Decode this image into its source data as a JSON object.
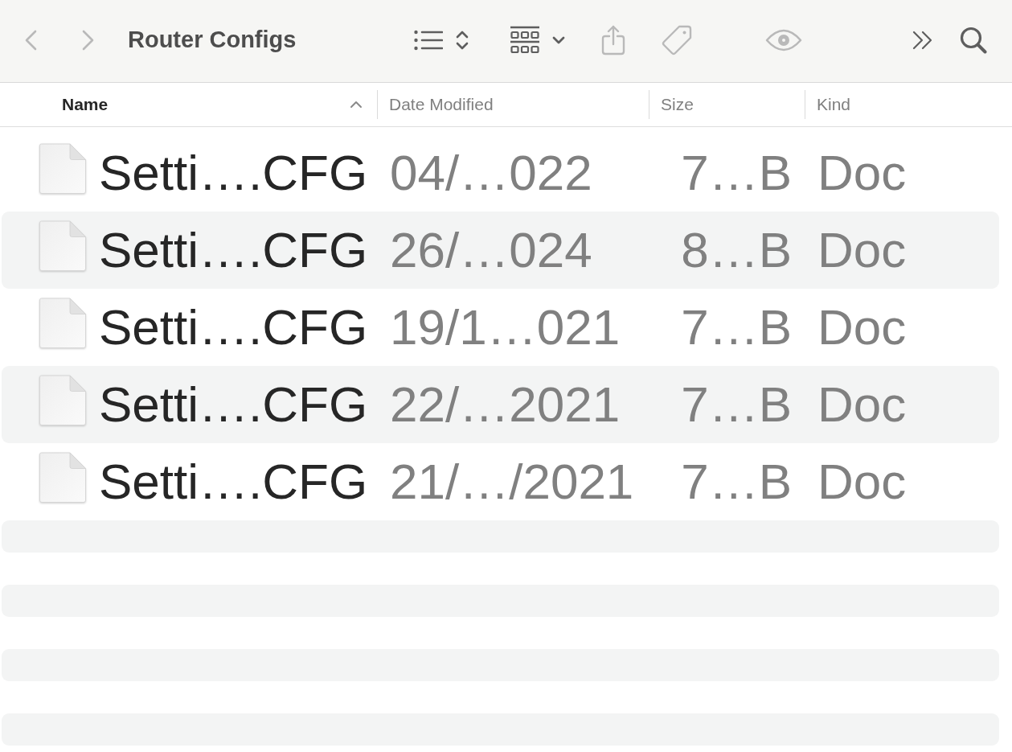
{
  "toolbar": {
    "back_button": {
      "disabled": true
    },
    "forward_button": {
      "disabled": true
    },
    "title": "Router Configs",
    "view_button": {
      "disabled": false
    },
    "group_button": {
      "disabled": false
    },
    "share_button": {
      "disabled": true
    },
    "tag_button": {
      "disabled": true
    },
    "quick_look_button": {
      "disabled": true
    },
    "more_button": {
      "disabled": false
    },
    "search_button": {
      "disabled": false
    }
  },
  "table": {
    "columns": [
      {
        "label": "Name",
        "sorted": true,
        "ascending": true
      },
      {
        "label": "Date Modified",
        "sorted": false
      },
      {
        "label": "Size",
        "sorted": false
      },
      {
        "label": "Kind",
        "sorted": false
      }
    ],
    "rows": [
      {
        "cells": [
          "Setti….CFG",
          "04/…022",
          "7…B",
          "Doc"
        ]
      },
      {
        "cells": [
          "Setti….CFG",
          "26/…024",
          "8…B",
          "Doc"
        ]
      },
      {
        "cells": [
          "Setti….CFG",
          "19/1…021",
          "7…B",
          "Doc"
        ]
      },
      {
        "cells": [
          "Setti….CFG",
          "22/…2021",
          "7…B",
          "Doc"
        ]
      },
      {
        "cells": [
          "Setti….CFG",
          "21/…/2021",
          "7…B",
          "Doc"
        ]
      }
    ]
  }
}
